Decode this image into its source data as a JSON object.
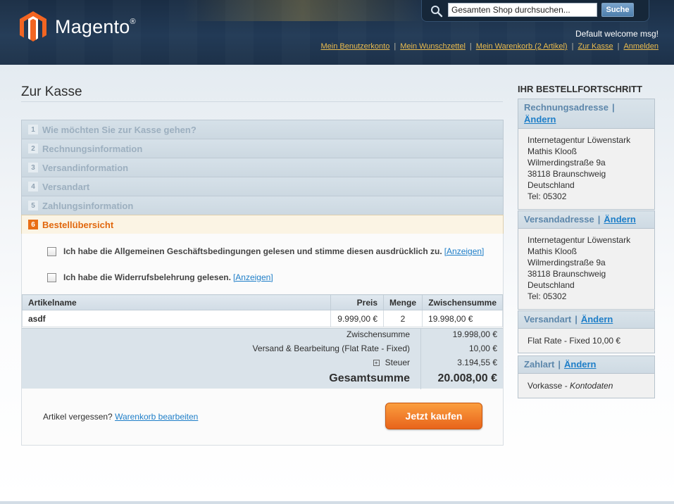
{
  "header": {
    "logo_text": "Magento",
    "logo_reg": "®",
    "search_placeholder": "Gesamten Shop durchsuchen...",
    "search_button": "Suche",
    "welcome": "Default welcome msg!",
    "links": [
      "Mein Benutzerkonto",
      "Mein Wunschzettel",
      "Mein Warenkorb (2 Artikel)",
      "Zur Kasse",
      "Anmelden"
    ]
  },
  "main": {
    "title": "Zur Kasse",
    "steps": [
      {
        "num": "1",
        "label": "Wie möchten Sie zur Kasse gehen?"
      },
      {
        "num": "2",
        "label": "Rechnungsinformation"
      },
      {
        "num": "3",
        "label": "Versandinformation"
      },
      {
        "num": "4",
        "label": "Versandart"
      },
      {
        "num": "5",
        "label": "Zahlungsinformation"
      },
      {
        "num": "6",
        "label": "Bestellübersicht"
      }
    ],
    "agreements": [
      {
        "text": "Ich habe die Allgemeinen Geschäftsbedingungen gelesen und stimme diesen ausdrücklich zu.",
        "link": "[Anzeigen]"
      },
      {
        "text": "Ich habe die Widerrufsbelehrung gelesen.",
        "link": "[Anzeigen]"
      }
    ],
    "table": {
      "headers": [
        "Artikelname",
        "Preis",
        "Menge",
        "Zwischensumme"
      ],
      "rows": [
        [
          "asdf",
          "9.999,00 €",
          "2",
          "19.998,00 €"
        ]
      ]
    },
    "totals": {
      "subtotal_label": "Zwischensumme",
      "subtotal_value": "19.998,00 €",
      "shipping_label": "Versand & Bearbeitung (Flat Rate - Fixed)",
      "shipping_value": "10,00 €",
      "tax_label": "Steuer",
      "tax_value": "3.194,55 €",
      "grand_label": "Gesamtsumme",
      "grand_value": "20.008,00 €"
    },
    "forgot_text": "Artikel vergessen?",
    "forgot_link": "Warenkorb bearbeiten",
    "buy_button": "Jetzt kaufen"
  },
  "sidebar": {
    "title": "IHR BESTELLFORTSCHRITT",
    "edit_label": "Ändern",
    "billing": {
      "title": "Rechnungsadresse",
      "lines": [
        "Internetagentur Löwenstark",
        "Mathis Klooß",
        "Wilmerdingstraße 9a",
        "38118 Braunschweig",
        "Deutschland",
        "Tel: 05302"
      ]
    },
    "shipping": {
      "title": "Versandadresse",
      "lines": [
        "Internetagentur Löwenstark",
        "Mathis Klooß",
        "Wilmerdingstraße 9a",
        "38118 Braunschweig",
        "Deutschland",
        "Tel: 05302"
      ]
    },
    "method": {
      "title": "Versandart",
      "text": "Flat Rate - Fixed 10,00 €"
    },
    "payment": {
      "title": "Zahlart",
      "text": "Vorkasse - ",
      "text_italic": "Kontodaten"
    }
  }
}
